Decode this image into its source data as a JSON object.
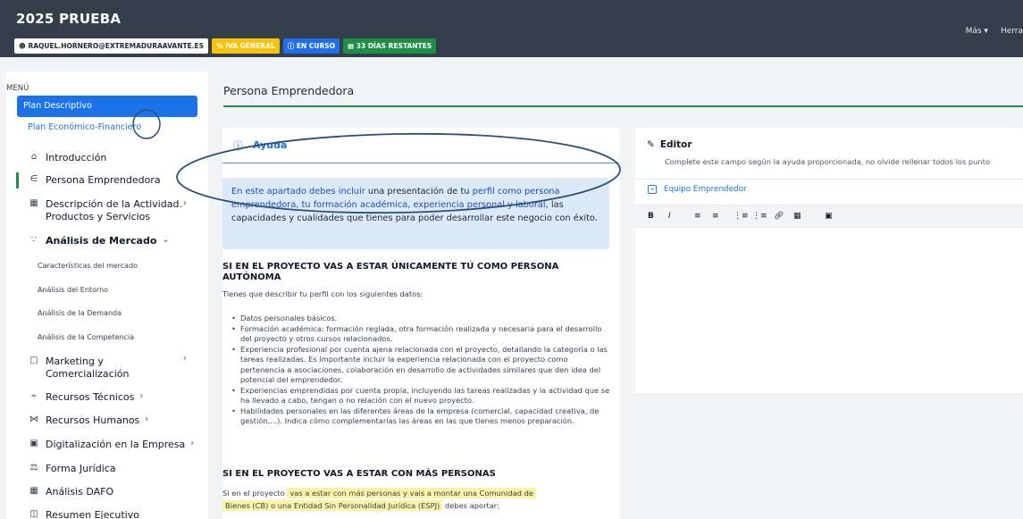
{
  "header": {
    "title": "2025 PRUEBA",
    "badges": {
      "user": "RAQUEL.HORNERO@EXTREMADURAAVANTE.ES",
      "iva": "IVA GENERAL",
      "curso": "EN CURSO",
      "dias": "33 DÍAS RESTANTES"
    },
    "links": {
      "mas": "Más ▾",
      "herr": "Herra"
    }
  },
  "sidebar": {
    "menu_label": "MENÚ",
    "plan_descriptivo": "Plan Descriptivo",
    "plan_economico": "Plan Económico-Financiero",
    "items": {
      "introduccion": "Introducción",
      "persona": "Persona Emprendedora",
      "descripcion_1": "Descripción de la Actividad.",
      "descripcion_2": "Productos y Servicios",
      "analisis_mercado": "Análisis de Mercado",
      "marketing_1": "Marketing y",
      "marketing_2": "Comercialización",
      "recursos_tecnicos": "Recursos Técnicos",
      "recursos_humanos": "Recursos Humanos",
      "digitalizacion": "Digitalización en la Empresa",
      "forma_juridica": "Forma Jurídica",
      "dafo": "Análisis DAFO",
      "resumen": "Resumen Ejecutivo"
    },
    "sub_items": {
      "caracteristicas": "Características del mercado",
      "entorno": "Análisis del Entorno",
      "demanda": "Análisis de la Demanda",
      "competencia": "Análisis de la Competencia"
    }
  },
  "main": {
    "page_title": "Persona Emprendedora",
    "help": {
      "title": "Ayuda",
      "info_1": "En este apartado debes incluir",
      "info_2": " una presentación de tu ",
      "info_3": "perfil como persona emprendedora, tu formación académica, experiencia personal y laboral,",
      "info_4": " las capacidades y cualidades que tienes para poder desarrollar este negocio con éxito.",
      "sec1_title": "SI EN EL PROYECTO VAS A ESTAR ÚNICAMENTE TÚ COMO PERSONA AUTÓNOMA",
      "sec1_intro": "Tienes que describir tu perfil con los siguientes datos:",
      "bullets": [
        "Datos personales básicos.",
        "Formación académica: formación reglada, otra formación realizada y necesaria para el desarrollo del proyecto y otros cursos relacionados.",
        "Experiencia profesional por cuenta ajena relacionada con el proyecto, detallando la categoría o las tareas realizadas. Es importante incluir la experiencia relacionada con el proyecto como pertenencia a asociaciones, colaboración en desarrollo de actividades similares que den idea del potencial del emprendedor.",
        "Experiencias emprendidas por cuenta propia, incluyendo las tareas realizadas y la actividad que se ha llevado a cabo, tengan o no relación con el nuevo proyecto.",
        "Habilidades personales en las diferentes áreas de la empresa (comercial, capacidad creativa, de gestión,...). Indica cómo complementarías las áreas en las que tienes menos preparación."
      ],
      "sec2_title": "SI EN EL PROYECTO VAS A ESTAR CON MÁS PERSONAS",
      "sec2_a": "Si en el proyecto ",
      "sec2_hl1": "vas a estar con más personas y vais a montar una Comunidad de",
      "sec2_hl2": "Bienes (CB) o una Entidad Sin Personalidad Jurídica (ESPJ)",
      "sec2_b": " debes aportar:"
    },
    "editor": {
      "title": "Editor",
      "subtitle": "Complete este campo según la ayuda proporcionada, no olvide rellenar todos los punto",
      "tab": "Equipo Emprendedor",
      "toolbar": {
        "bold": "B",
        "italic": "I"
      }
    }
  },
  "colors": {
    "header_bg": "#353f4c",
    "accent_blue": "#1a73e8",
    "accent_green": "#1f8e4a",
    "iva_yellow": "#f6c20c",
    "annotation": "#2c4f7a"
  },
  "icons": [
    "user-icon",
    "percent-icon",
    "info-icon",
    "calendar-icon",
    "home-icon",
    "people-icon",
    "calculator-icon",
    "chart-icon",
    "bag-icon",
    "tools-icon",
    "users-icon",
    "laptop-icon",
    "scale-icon",
    "grid-icon",
    "doc-icon",
    "help-icon",
    "pencil-icon"
  ]
}
